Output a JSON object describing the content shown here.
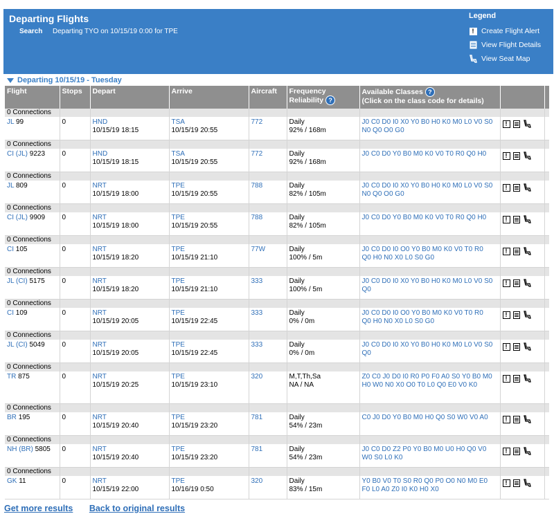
{
  "header": {
    "title": "Departing Flights",
    "search_label": "Search",
    "search_text": "Departing TYO on 10/15/19 0:00 for TPE"
  },
  "legend": {
    "title": "Legend",
    "items": [
      {
        "label": "Create Flight Alert",
        "icon": "alert-icon"
      },
      {
        "label": "View Flight Details",
        "icon": "details-icon"
      },
      {
        "label": "View Seat Map",
        "icon": "seat-icon"
      }
    ]
  },
  "section_title": "Departing 10/15/19 - Tuesday",
  "columns": {
    "flight": "Flight",
    "stops": "Stops",
    "depart": "Depart",
    "arrive": "Arrive",
    "aircraft": "Aircraft",
    "frequency": "Frequency",
    "reliability": "Reliability",
    "classes": "Available Classes",
    "classes_sub": "(Click on the class code for details)"
  },
  "flights": [
    {
      "conn": "0 Connections",
      "carrier": "JL",
      "op": "",
      "num": "99",
      "stops": "0",
      "dep_ap": "HND",
      "dep_time": "10/15/19 18:15",
      "arr_ap": "TSA",
      "arr_time": "10/15/19 20:55",
      "aircraft": "772",
      "freq": "Daily",
      "rel": "92% / 168m",
      "classes1": "J0 C0 D0 I0 X0 Y0 B0 H0 K0 M0 L0 V0 S0",
      "classes2": "N0 Q0 O0 G0"
    },
    {
      "conn": "0 Connections",
      "carrier": "CI",
      "op": "(JL)",
      "num": "9223",
      "stops": "0",
      "dep_ap": "HND",
      "dep_time": "10/15/19 18:15",
      "arr_ap": "TSA",
      "arr_time": "10/15/19 20:55",
      "aircraft": "772",
      "freq": "Daily",
      "rel": "92% / 168m",
      "classes1": "J0 C0 D0 Y0 B0 M0 K0 V0 T0 R0 Q0 H0",
      "classes2": ""
    },
    {
      "conn": "0 Connections",
      "carrier": "JL",
      "op": "",
      "num": "809",
      "stops": "0",
      "dep_ap": "NRT",
      "dep_time": "10/15/19 18:00",
      "arr_ap": "TPE",
      "arr_time": "10/15/19 20:55",
      "aircraft": "788",
      "freq": "Daily",
      "rel": "82% / 105m",
      "classes1": "J0 C0 D0 I0 X0 Y0 B0 H0 K0 M0 L0 V0 S0",
      "classes2": "N0 Q0 O0 G0"
    },
    {
      "conn": "0 Connections",
      "carrier": "CI",
      "op": "(JL)",
      "num": "9909",
      "stops": "0",
      "dep_ap": "NRT",
      "dep_time": "10/15/19 18:00",
      "arr_ap": "TPE",
      "arr_time": "10/15/19 20:55",
      "aircraft": "788",
      "freq": "Daily",
      "rel": "82% / 105m",
      "classes1": "J0 C0 D0 Y0 B0 M0 K0 V0 T0 R0 Q0 H0",
      "classes2": ""
    },
    {
      "conn": "0 Connections",
      "carrier": "CI",
      "op": "",
      "num": "105",
      "stops": "0",
      "dep_ap": "NRT",
      "dep_time": "10/15/19 18:20",
      "arr_ap": "TPE",
      "arr_time": "10/15/19 21:10",
      "aircraft": "77W",
      "freq": "Daily",
      "rel": "100% / 5m",
      "classes1": "J0 C0 D0 I0 O0 Y0 B0 M0 K0 V0 T0 R0",
      "classes2": "Q0 H0 N0 X0 L0 S0 G0"
    },
    {
      "conn": "0 Connections",
      "carrier": "JL",
      "op": "(CI)",
      "num": "5175",
      "stops": "0",
      "dep_ap": "NRT",
      "dep_time": "10/15/19 18:20",
      "arr_ap": "TPE",
      "arr_time": "10/15/19 21:10",
      "aircraft": "333",
      "freq": "Daily",
      "rel": "100% / 5m",
      "classes1": "J0 C0 D0 I0 X0 Y0 B0 H0 K0 M0 L0 V0 S0",
      "classes2": "Q0"
    },
    {
      "conn": "0 Connections",
      "carrier": "CI",
      "op": "",
      "num": "109",
      "stops": "0",
      "dep_ap": "NRT",
      "dep_time": "10/15/19 20:05",
      "arr_ap": "TPE",
      "arr_time": "10/15/19 22:45",
      "aircraft": "333",
      "freq": "Daily",
      "rel": "0% / 0m",
      "classes1": "J0 C0 D0 I0 O0 Y0 B0 M0 K0 V0 T0 R0",
      "classes2": "Q0 H0 N0 X0 L0 S0 G0"
    },
    {
      "conn": "0 Connections",
      "carrier": "JL",
      "op": "(CI)",
      "num": "5049",
      "stops": "0",
      "dep_ap": "NRT",
      "dep_time": "10/15/19 20:05",
      "arr_ap": "TPE",
      "arr_time": "10/15/19 22:45",
      "aircraft": "333",
      "freq": "Daily",
      "rel": "0% / 0m",
      "classes1": "J0 C0 D0 I0 X0 Y0 B0 H0 K0 M0 L0 V0 S0",
      "classes2": "Q0"
    },
    {
      "conn": "0 Connections",
      "carrier": "TR",
      "op": "",
      "num": "875",
      "stops": "0",
      "dep_ap": "NRT",
      "dep_time": "10/15/19 20:25",
      "arr_ap": "TPE",
      "arr_time": "10/15/19 23:10",
      "aircraft": "320",
      "freq": "M,T,Th,Sa",
      "rel": "NA / NA",
      "classes1": "Z0 C0 J0 D0 I0 R0 P0 F0 A0 S0 Y0 B0 M0",
      "classes2": "H0 W0 N0 X0 O0 T0 L0 Q0 E0 V0 K0",
      "tall": true
    },
    {
      "conn": "0 Connections",
      "carrier": "BR",
      "op": "",
      "num": "195",
      "stops": "0",
      "dep_ap": "NRT",
      "dep_time": "10/15/19 20:40",
      "arr_ap": "TPE",
      "arr_time": "10/15/19 23:20",
      "aircraft": "781",
      "freq": "Daily",
      "rel": "54% / 23m",
      "classes1": "C0 J0 D0 Y0 B0 M0 H0 Q0 S0 W0 V0 A0",
      "classes2": ""
    },
    {
      "conn": "0 Connections",
      "carrier": "NH",
      "op": "(BR)",
      "num": "5805",
      "stops": "0",
      "dep_ap": "NRT",
      "dep_time": "10/15/19 20:40",
      "arr_ap": "TPE",
      "arr_time": "10/15/19 23:20",
      "aircraft": "781",
      "freq": "Daily",
      "rel": "54% / 23m",
      "classes1": "J0 C0 D0 Z2 P0 Y0 B0 M0 U0 H0 Q0 V0",
      "classes2": "W0 S0 L0 K0"
    },
    {
      "conn": "0 Connections",
      "carrier": "GK",
      "op": "",
      "num": "11",
      "stops": "0",
      "dep_ap": "NRT",
      "dep_time": "10/15/19 22:00",
      "arr_ap": "TPE",
      "arr_time": "10/16/19 0:50",
      "aircraft": "320",
      "freq": "Daily",
      "rel": "83% / 15m",
      "classes1": "Y0 B0 V0 T0 S0 R0 Q0 P0 O0 N0 M0 E0",
      "classes2": "F0 L0 A0 Z0 I0 K0 H0 X0"
    }
  ],
  "footer": {
    "more_results": "Get more results",
    "back": "Back to original results"
  }
}
